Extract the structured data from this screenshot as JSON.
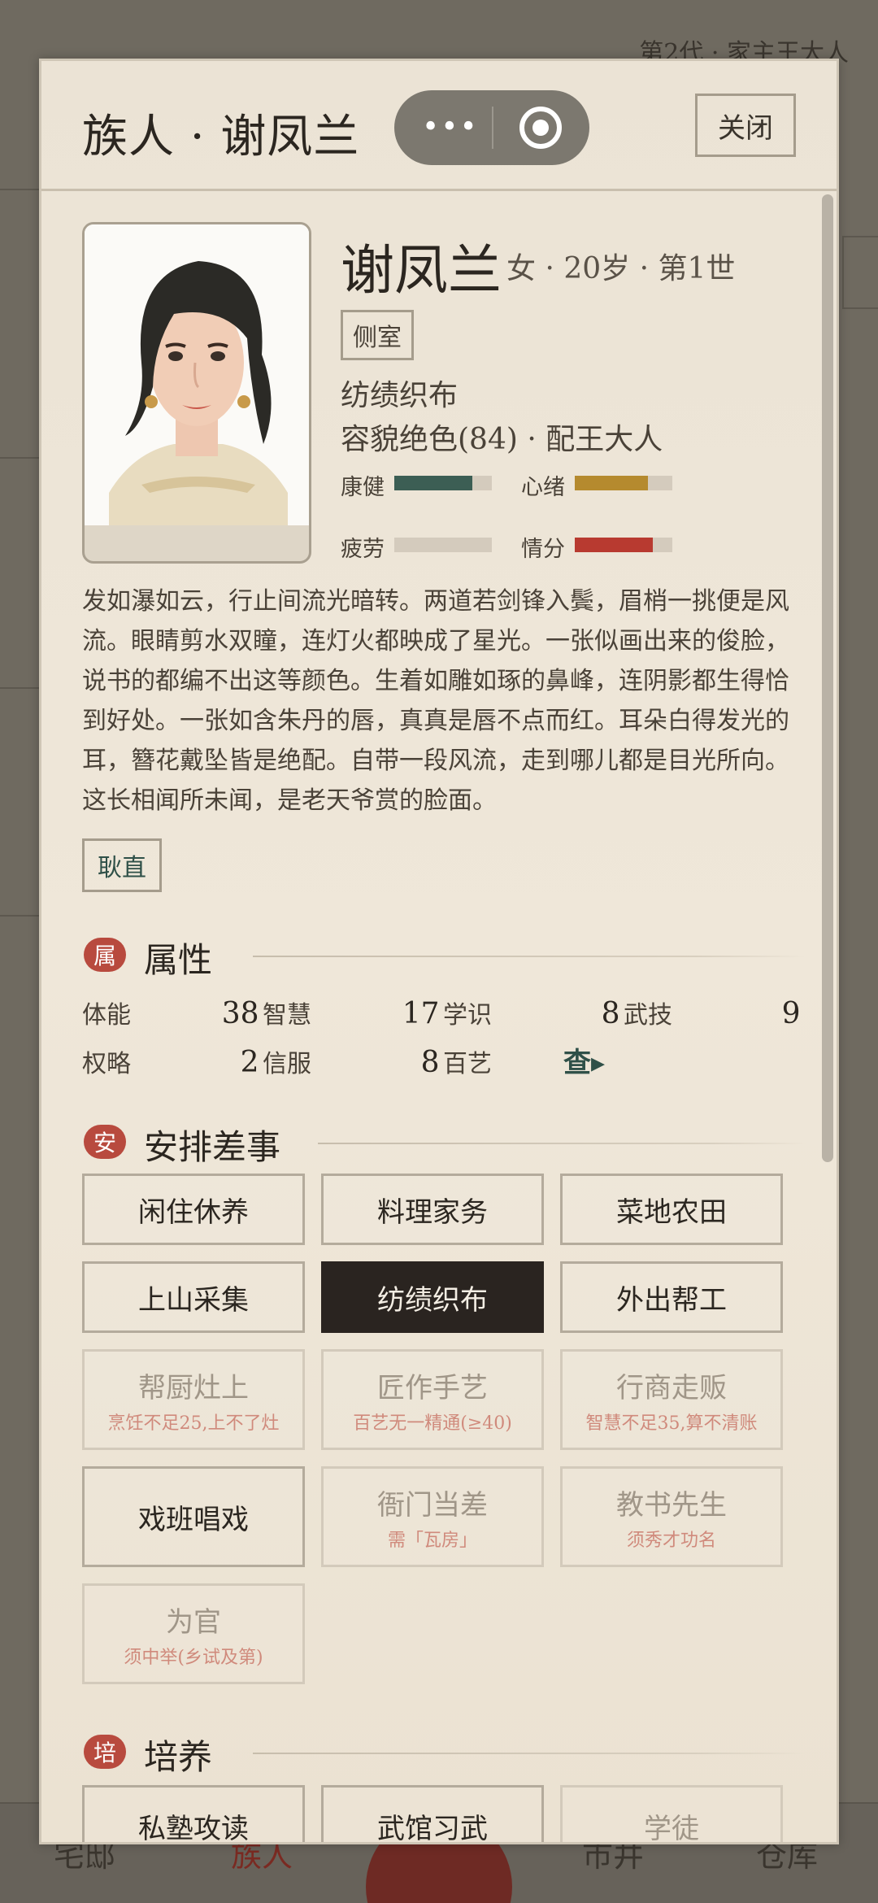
{
  "background": {
    "generation_text": "第2代 · 家主王大人",
    "nav": [
      "宅邸",
      "族人",
      "市井",
      "仓库"
    ]
  },
  "modal": {
    "title": "族人 · 谢凤兰",
    "close_label": "关闭",
    "menu_icon": "more-dots-icon",
    "target_icon": "target-icon"
  },
  "profile": {
    "name": "谢凤兰",
    "meta": "女 · 20岁 · 第1世",
    "tag": "侧室",
    "occupation": "纺绩织布",
    "beauty": "容貌绝色(84) · 配王大人",
    "stats": [
      {
        "label": "康健",
        "value": 0.8,
        "color": "#3c5e54"
      },
      {
        "label": "心绪",
        "value": 0.75,
        "color": "#b58a2e"
      },
      {
        "label": "疲劳",
        "value": 0.0,
        "color": "#9a9080"
      },
      {
        "label": "情分",
        "value": 0.8,
        "color": "#b83a30"
      }
    ],
    "description": "发如瀑如云，行止间流光暗转。两道若剑锋入鬓，眉梢一挑便是风流。眼睛剪水双瞳，连灯火都映成了星光。一张似画出来的俊脸，说书的都编不出这等颜色。生着如雕如琢的鼻峰，连阴影都生得恰到好处。一张如含朱丹的唇，真真是唇不点而红。耳朵白得发光的耳，簪花戴坠皆是绝配。自带一段风流，走到哪儿都是目光所向。这长相闻所未闻，是老天爷赏的脸面。",
    "trait": "耿直"
  },
  "attributes": {
    "badge": "属",
    "title": "属性",
    "items": [
      {
        "label": "体能",
        "value": "38"
      },
      {
        "label": "智慧",
        "value": "17"
      },
      {
        "label": "学识",
        "value": "8"
      },
      {
        "label": "武技",
        "value": "9"
      },
      {
        "label": "权略",
        "value": "2"
      },
      {
        "label": "信服",
        "value": "8"
      },
      {
        "label": "百艺",
        "value": ""
      }
    ],
    "query_label": "查▸"
  },
  "jobs": {
    "badge": "安",
    "title": "安排差事",
    "items": [
      {
        "name": "闲住休养",
        "note": "",
        "state": "normal"
      },
      {
        "name": "料理家务",
        "note": "",
        "state": "normal"
      },
      {
        "name": "菜地农田",
        "note": "",
        "state": "normal"
      },
      {
        "name": "上山采集",
        "note": "",
        "state": "normal"
      },
      {
        "name": "纺绩织布",
        "note": "",
        "state": "active"
      },
      {
        "name": "外出帮工",
        "note": "",
        "state": "normal"
      },
      {
        "name": "帮厨灶上",
        "note": "烹饪不足25,上不了灶",
        "state": "disabled"
      },
      {
        "name": "匠作手艺",
        "note": "百艺无一精通(≥40)",
        "state": "disabled"
      },
      {
        "name": "行商走贩",
        "note": "智慧不足35,算不清账",
        "state": "disabled"
      },
      {
        "name": "戏班唱戏",
        "note": "",
        "state": "normal"
      },
      {
        "name": "衙门当差",
        "note": "需「瓦房」",
        "state": "disabled"
      },
      {
        "name": "教书先生",
        "note": "须秀才功名",
        "state": "disabled"
      },
      {
        "name": "为官",
        "note": "须中举(乡试及第)",
        "state": "disabled"
      }
    ]
  },
  "training": {
    "badge": "培",
    "title": "培养",
    "items": [
      {
        "name": "私塾攻读",
        "state": "normal"
      },
      {
        "name": "武馆习武",
        "state": "normal"
      },
      {
        "name": "学徒",
        "state": "disabled"
      }
    ]
  }
}
